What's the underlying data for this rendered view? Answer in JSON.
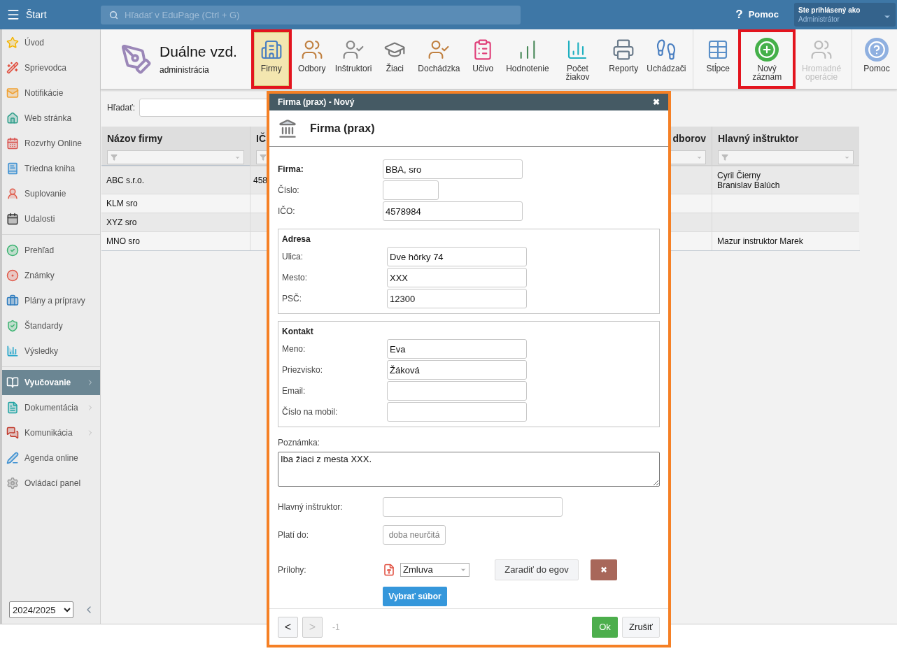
{
  "top_bar": {
    "title": "Štart",
    "search": {
      "placeholder": "Hľadať v EduPage (Ctrl + G)"
    },
    "help": "Pomoc",
    "help_glyph": "?",
    "user": {
      "caption": "Ste prihlásený ako",
      "role": "Administrátor"
    }
  },
  "sidebar": {
    "sections": [
      {
        "items": [
          {
            "label": "Úvod",
            "selected": false,
            "submenu": false
          },
          {
            "label": "Sprievodca",
            "selected": false,
            "submenu": false
          },
          {
            "label": "Notifikácie",
            "selected": false,
            "submenu": false
          },
          {
            "label": "Web stránka",
            "selected": false,
            "submenu": false
          },
          {
            "label": "Rozvrhy Online",
            "selected": false,
            "submenu": false
          },
          {
            "label": "Triedna kniha",
            "selected": false,
            "submenu": false
          },
          {
            "label": "Suplovanie",
            "selected": false,
            "submenu": false
          },
          {
            "label": "Udalosti",
            "selected": false,
            "submenu": false
          }
        ]
      },
      {
        "items": [
          {
            "label": "Prehľad",
            "selected": false,
            "submenu": false
          },
          {
            "label": "Známky",
            "selected": false,
            "submenu": false
          },
          {
            "label": "Plány a prípravy",
            "selected": false,
            "submenu": false
          },
          {
            "label": "Štandardy",
            "selected": false,
            "submenu": false
          },
          {
            "label": "Výsledky",
            "selected": false,
            "submenu": false
          }
        ]
      },
      {
        "items": [
          {
            "label": "Vyučovanie",
            "selected": true,
            "submenu": true
          },
          {
            "label": "Dokumentácia",
            "selected": false,
            "submenu": true
          },
          {
            "label": "Komunikácia",
            "selected": false,
            "submenu": true
          },
          {
            "label": "Agenda online",
            "selected": false,
            "submenu": false
          },
          {
            "label": "Ovládací panel",
            "selected": false,
            "submenu": false
          }
        ]
      }
    ],
    "year": "2024/2025"
  },
  "module": {
    "title": "Duálne vzd.",
    "subtitle": "administrácia"
  },
  "toolbar": {
    "groups": [
      [
        {
          "label": "Firmy",
          "selected": true,
          "highlighted": true,
          "disabled": false
        },
        {
          "label": "Odbory",
          "selected": false,
          "highlighted": false,
          "disabled": false
        },
        {
          "label": "Inštruktori",
          "selected": false,
          "highlighted": false,
          "disabled": false
        },
        {
          "label": "Žiaci",
          "selected": false,
          "highlighted": false,
          "disabled": false
        },
        {
          "label": "Dochádzka",
          "selected": false,
          "highlighted": false,
          "disabled": false
        },
        {
          "label": "Učivo",
          "selected": false,
          "highlighted": false,
          "disabled": false
        },
        {
          "label": "Hodnotenie",
          "selected": false,
          "highlighted": false,
          "disabled": false
        },
        {
          "label": "Počet žiakov",
          "selected": false,
          "highlighted": false,
          "disabled": false
        },
        {
          "label": "Reporty",
          "selected": false,
          "highlighted": false,
          "disabled": false
        },
        {
          "label": "Uchádzači",
          "selected": false,
          "highlighted": false,
          "disabled": false
        }
      ],
      [
        {
          "label": "Stĺpce",
          "selected": false,
          "highlighted": false,
          "disabled": false
        },
        {
          "label": "Nový záznam",
          "selected": false,
          "highlighted": true,
          "disabled": false
        },
        {
          "label": "Hromadné operácie",
          "selected": false,
          "highlighted": false,
          "disabled": true
        }
      ],
      [
        {
          "label": "Pomoc",
          "selected": false,
          "highlighted": false,
          "disabled": false
        }
      ]
    ]
  },
  "search": {
    "label": "Hľadať:"
  },
  "table": {
    "columns": [
      "Názov firmy",
      "IČ",
      "dborov",
      "Hlavný inštruktor"
    ],
    "rows": [
      [
        "ABC s.r.o.",
        "458",
        "",
        "Cyril Čierny\nBranislav Balúch"
      ],
      [
        "KLM sro",
        "",
        "",
        ""
      ],
      [
        "XYZ sro",
        "",
        "",
        ""
      ],
      [
        "MNO sro",
        "",
        "",
        "Mazur instruktor Marek"
      ]
    ]
  },
  "dialog": {
    "title": "Firma (prax) - Nový",
    "close": "✖",
    "heading": "Firma (prax)",
    "fields": [
      {
        "label": "Firma:",
        "value": "BBA, sro",
        "bold": true
      },
      {
        "label": "Číslo:",
        "bold": false
      },
      {
        "label": "IČO:",
        "value": "4578984",
        "bold": false
      }
    ],
    "sections": [
      {
        "title": "Adresa",
        "fields": [
          {
            "label": "Ulica:",
            "value": "Dve hôrky 74"
          },
          {
            "label": "Mesto:",
            "value": "XXX"
          },
          {
            "label": "PSČ:",
            "value": "12300"
          }
        ]
      },
      {
        "title": "Kontakt",
        "fields": [
          {
            "label": "Meno:",
            "value": "Eva"
          },
          {
            "label": "Priezvisko:",
            "value": "Žáková"
          },
          {
            "label": "Email:"
          },
          {
            "label": "Číslo na mobil:"
          }
        ]
      }
    ],
    "note": {
      "label": "Poznámka:",
      "value": "Iba žiaci z mesta XXX."
    },
    "instructor": {
      "label": "Hlavný inštruktor:"
    },
    "valid_until": {
      "label": "Platí do:",
      "placeholder": "doba neurčitá"
    },
    "attachments": {
      "label": "Prílohy:",
      "type": "Zmluva",
      "egov": "Zaradiť do egov",
      "remove": "✖",
      "choose": "Vybrať súbor"
    },
    "footer": {
      "prev": {
        "label": "<",
        "disabled": false
      },
      "next": {
        "label": ">",
        "disabled": true
      },
      "counter": "-1",
      "ok": "Ok",
      "cancel": "Zrušiť"
    }
  }
}
